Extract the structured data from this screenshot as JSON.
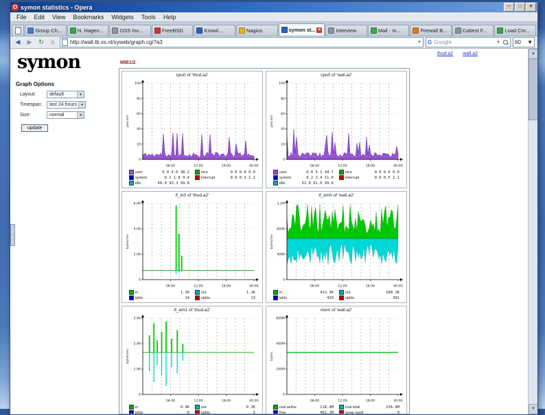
{
  "window": {
    "title": "symon statistics - Opera"
  },
  "menubar": {
    "items": [
      "File",
      "Edit",
      "View",
      "Bookmarks",
      "Widgets",
      "Tools",
      "Help"
    ]
  },
  "tabs": {
    "active_index": 6,
    "items": [
      {
        "label": "Group Ch...",
        "color": "#4a7cc4"
      },
      {
        "label": "N. Hagen...",
        "color": "#3aa64a"
      },
      {
        "label": "OSS Inv...",
        "color": "#8a94a0"
      },
      {
        "label": "FreeBSD",
        "color": "#c43a3a"
      },
      {
        "label": "Knowl...",
        "color": "#2a62b8"
      },
      {
        "label": "Nagios",
        "color": "#e0b020"
      },
      {
        "label": "symon st...",
        "color": "#2a62b8"
      },
      {
        "label": "Interview",
        "color": "#8a94a0"
      },
      {
        "label": "Mail - In...",
        "color": "#3aa64a"
      },
      {
        "label": "Firewall B...",
        "color": "#e07820"
      },
      {
        "label": "Cabest F...",
        "color": "#8a94a0"
      },
      {
        "label": "Load Cm...",
        "color": "#3aa64a"
      }
    ]
  },
  "navbar": {
    "url": "http://wall.tb.xs.nl/syweb/graph.cgi?a3",
    "search_label": "Google",
    "zoom": "60"
  },
  "page": {
    "host_links": [
      "thud.a2",
      "wall.a2"
    ],
    "heading": "MIB1/2",
    "sidebar": {
      "logo": "symon",
      "options_title": "Graph Options",
      "fields": [
        {
          "label": "Layout",
          "value": "default"
        },
        {
          "label": "Timespan",
          "value": "last 24 hours"
        },
        {
          "label": "Size",
          "value": "normal"
        }
      ],
      "update_label": "update"
    },
    "graphs": [
      {
        "title": "cpu0 of 'thud.a2'",
        "type": "cpu",
        "seed": 11,
        "ylabel": "percent",
        "y_ticks": [
          "0",
          "20",
          "40",
          "60",
          "80",
          "100"
        ],
        "x_ticks": [
          "06:00",
          "12:00",
          "18:00",
          "00:00"
        ],
        "legend": [
          {
            "color": "#9a52d8",
            "label": "user",
            "values": "0.0 4.6 38.2"
          },
          {
            "color": "#00b000",
            "label": "nice",
            "values": "0.0 0.0 0.0"
          },
          {
            "color": "#0000c0",
            "label": "system",
            "values": "0.1 1.8 9.4"
          },
          {
            "color": "#c00000",
            "label": "interrupt",
            "values": "0.0 0.3 1.2"
          },
          {
            "color": "#00b0b0",
            "label": "idle",
            "values": "60.4 93.3 99.8"
          }
        ]
      },
      {
        "title": "cpu0 of 'wall.a2'",
        "type": "cpu",
        "seed": 23,
        "ylabel": "percent",
        "y_ticks": [
          "0",
          "20",
          "40",
          "60",
          "80",
          "100"
        ],
        "x_ticks": [
          "06:00",
          "12:00",
          "18:00",
          "00:00"
        ],
        "legend": [
          {
            "color": "#9a52d8",
            "label": "user",
            "values": "0.0 6.1 44.7"
          },
          {
            "color": "#00b000",
            "label": "nice",
            "values": "0.0 0.0 0.0"
          },
          {
            "color": "#0000c0",
            "label": "system",
            "values": "0.2 2.4 11.6"
          },
          {
            "color": "#c00000",
            "label": "interrupt",
            "values": "0.0 0.5 2.1"
          },
          {
            "color": "#00b0b0",
            "label": "idle",
            "values": "52.8 91.0 99.6"
          }
        ]
      },
      {
        "title": "if_lo0 of 'thud.a2'",
        "type": "spikes",
        "baseline": 0.88,
        "ylabel": "bytes/sec",
        "clusters": [
          [
            0.3,
            0.97,
            0.35
          ],
          [
            0.325,
            0.55,
            0.2
          ],
          [
            0.35,
            0.22,
            0.1
          ]
        ],
        "y_ticks": [
          "0",
          "2.0K",
          "4.0K",
          "6.0K"
        ],
        "x_ticks": [
          "06:00",
          "12:00",
          "18:00",
          "00:00"
        ],
        "legend": [
          {
            "color": "#00b000",
            "label": "in",
            "values": "1.2K"
          },
          {
            "color": "#00b0b0",
            "label": "out",
            "values": "1.1K"
          },
          {
            "color": "#0000c0",
            "label": "ipkts",
            "values": "14"
          },
          {
            "color": "#c00000",
            "label": "opkts",
            "values": "13"
          }
        ]
      },
      {
        "title": "if_em0 of 'wall.a2'",
        "type": "inout",
        "seed": 37,
        "baseline": 0.46,
        "ylabel": "bytes/sec",
        "y_ticks": [
          "0",
          "400K",
          "800K",
          "1.2M"
        ],
        "x_ticks": [
          "06:00",
          "12:00",
          "18:00",
          "00:00"
        ],
        "legend": [
          {
            "color": "#00b000",
            "label": "in",
            "values": "412.3K"
          },
          {
            "color": "#00b0b0",
            "label": "out",
            "values": "188.1K"
          },
          {
            "color": "#0000c0",
            "label": "ipkts",
            "values": "420"
          },
          {
            "color": "#c00000",
            "label": "opkts",
            "values": "391"
          }
        ]
      },
      {
        "title": "if_em1 of 'thud.a2'",
        "type": "spikes",
        "baseline": 0.45,
        "ylabel": "bytes/sec",
        "clusters": [
          [
            0.06,
            0.5,
            0.45
          ],
          [
            0.1,
            0.85,
            0.7
          ],
          [
            0.13,
            0.35,
            0.3
          ],
          [
            0.17,
            0.6,
            0.55
          ],
          [
            0.21,
            0.9,
            0.8
          ],
          [
            0.26,
            0.4,
            0.35
          ],
          [
            0.31,
            0.65,
            0.5
          ],
          [
            0.36,
            0.25,
            0.2
          ]
        ],
        "y_ticks": [
          "0",
          "1.0K",
          "2.0K",
          "3.0K"
        ],
        "x_ticks": [
          "06:00",
          "12:00",
          "18:00",
          "00:00"
        ],
        "legend": [
          {
            "color": "#00b000",
            "label": "in",
            "values": "0.4K"
          },
          {
            "color": "#00b0b0",
            "label": "out",
            "values": "0.3K"
          },
          {
            "color": "#0000c0",
            "label": "ipkts",
            "values": "6"
          },
          {
            "color": "#c00000",
            "label": "opkts",
            "values": "5"
          }
        ]
      },
      {
        "title": "mem of 'wall.a2'",
        "type": "flat",
        "level": 0.45,
        "ylabel": "bytes",
        "y_ticks": [
          "0",
          "200M",
          "400M",
          "600M"
        ],
        "x_ticks": [
          "06:00",
          "12:00",
          "18:00",
          "00:00"
        ],
        "legend": [
          {
            "color": "#00b000",
            "label": "real active",
            "values": "118.4M"
          },
          {
            "color": "#00b0b0",
            "label": "real total",
            "values": "236.9M"
          },
          {
            "color": "#0000c0",
            "label": "free",
            "values": "402.1M"
          },
          {
            "color": "#c00000",
            "label": "swap used",
            "values": "0"
          }
        ]
      }
    ]
  }
}
